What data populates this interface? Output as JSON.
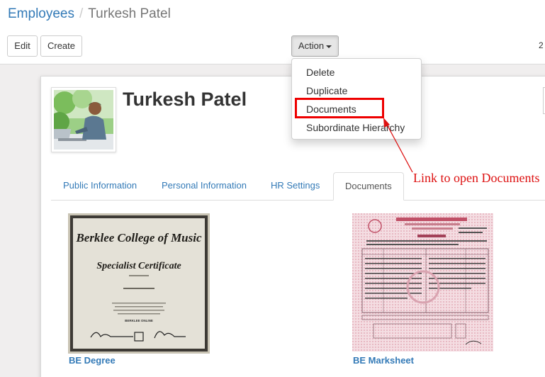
{
  "breadcrumb": {
    "parent": "Employees",
    "separator": "/",
    "current": "Turkesh Patel"
  },
  "toolbar": {
    "edit_label": "Edit",
    "create_label": "Create",
    "action_label": "Action",
    "pager_text": "2"
  },
  "employee": {
    "name": "Turkesh Patel"
  },
  "tabs": [
    {
      "label": "Public Information"
    },
    {
      "label": "Personal Information"
    },
    {
      "label": "HR Settings"
    },
    {
      "label": "Documents"
    }
  ],
  "action_menu": {
    "items": [
      "Delete",
      "Duplicate",
      "Documents",
      "Subordinate Hierarchy"
    ]
  },
  "documents": [
    {
      "name": "BE Degree",
      "certificate_lines": [
        "Berklee College of Music",
        "Specialist Certificate",
        "BERKLEE ONLINE"
      ]
    },
    {
      "name": "BE Marksheet"
    }
  ],
  "annotation": {
    "text": "Link to open Documents",
    "color": "#dd1111"
  },
  "colors": {
    "link": "#337ab7",
    "highlight": "#ee0000"
  }
}
